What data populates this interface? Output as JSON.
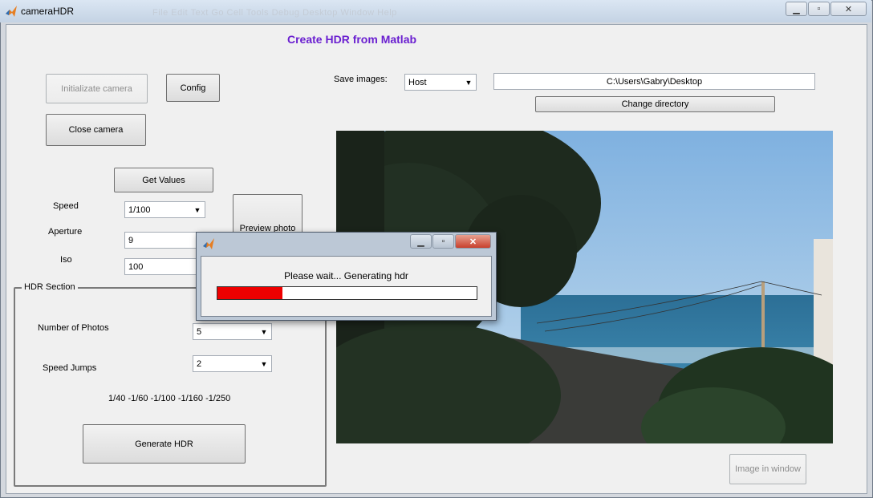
{
  "window": {
    "title": "cameraHDR",
    "ghost_menu": "File  Edit  Text  Go  Cell  Tools  Debug  Desktop  Window  Help",
    "minimize_icon": "minimize-icon",
    "maximize_icon": "maximize-icon",
    "close_icon": "close-icon"
  },
  "heading": "Create HDR from Matlab",
  "camera": {
    "init_label": "Initializate camera",
    "config_label": "Config",
    "close_label": "Close camera",
    "get_values_label": "Get Values",
    "preview_label": "Preview photo",
    "speed_label": "Speed",
    "speed_value": "1/100",
    "aperture_label": "Aperture",
    "aperture_value": "9",
    "iso_label": "Iso",
    "iso_value": "100"
  },
  "save": {
    "label": "Save images:",
    "location": "Host",
    "directory": "C:\\Users\\Gabry\\Desktop",
    "change_label": "Change directory"
  },
  "hdr": {
    "section_title": "HDR Section",
    "photos_label": "Number of Photos",
    "photos_value": "5",
    "jumps_label": "Speed Jumps",
    "jumps_value": "2",
    "speeds_text": "1/40 -1/60 -1/100 -1/160 -1/250",
    "generate_label": "Generate HDR"
  },
  "image_window_label": "Image in window",
  "dialog": {
    "message": "Please wait... Generating hdr",
    "progress": 0.25
  },
  "colors": {
    "heading": "#6a1fd0",
    "progress": "#ee0000"
  }
}
